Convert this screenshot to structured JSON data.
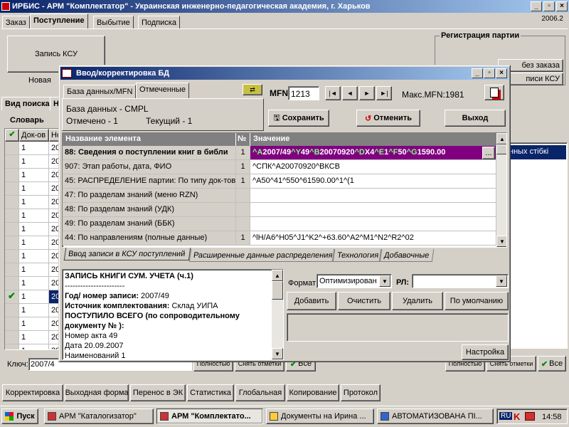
{
  "main_window": {
    "title": "ИРБИС - АРМ \"Комплектатор\" - Украинская инженерно-педагогическая академия, г. Харьков",
    "version": "2006.2",
    "tabs": [
      "Заказ",
      "Поступление",
      "Выбытие",
      "Подписка"
    ],
    "record_ksu": "Запись КСУ",
    "new_label": "Новая",
    "registration": "Регистрация партии",
    "btn_order": "без заказа",
    "btn_ksu": "писи КСУ",
    "search_tabs": [
      "Вид поиска",
      "Н"
    ],
    "dictionary": "Словарь",
    "grid_cols": [
      "Док-ов",
      "Но"
    ],
    "rows": [
      "1",
      "1",
      "1",
      "1",
      "1",
      "1",
      "1",
      "1",
      "1",
      "1",
      "1",
      "1",
      "1",
      "1",
      "1",
      "1"
    ],
    "right_cell": "нных стібкі",
    "key_label": "Ключ:",
    "key_value": "2007/4",
    "btn_full": "Полностью",
    "btn_clear": "Снять отметки",
    "btn_all": "Все"
  },
  "bottom_tabs": [
    "Корректировка",
    "Выходная форма",
    "Перенос в ЭК",
    "Статистика",
    "Глобальная",
    "Копирование",
    "Протокол"
  ],
  "taskbar": {
    "start": "Пуск",
    "tasks": [
      "АРМ \"Каталогизатор\"",
      "АРМ \"Комплектато...",
      "Документы на Ирина ...",
      "АВТОМАТИЗОВАНА ПІ..."
    ],
    "lang": "RU",
    "time": "14:58"
  },
  "dialog": {
    "title": "Ввод/корректировка БД",
    "db_tabs": [
      "База данных/MFN",
      "Отмеченные"
    ],
    "db_label": "База данных -",
    "db_name": "CMPL",
    "marked": "Отмечено - 1",
    "current": "Текущий - 1",
    "mfn_label": "MFN",
    "mfn_value": "1213",
    "max_mfn": "Макс.MFN:1981",
    "nav": [
      "|◄",
      "◄",
      "►",
      "►|"
    ],
    "btn_save": "Сохранить",
    "btn_cancel": "Отменить",
    "btn_exit": "Выход",
    "cols": [
      "Название элемента",
      "№",
      "Значение"
    ],
    "rows": [
      {
        "name": "88: Сведения о поступлении книг в библи",
        "num": "1",
        "value": "^A2007/49^Y49^B20070920^DX4^E1^F50^G1590.00"
      },
      {
        "name": "907: Этап работы, дата, ФИО",
        "num": "1",
        "value": "^CПК^A20070920^BКСВ"
      },
      {
        "name": "45: РАСПРЕДЕЛЕНИЕ партии: По типу док-тов",
        "num": "1",
        "value": "^A50^41^550^61590.00^1^(1"
      },
      {
        "name": "47: По разделам знаний (меню RZN)",
        "num": "",
        "value": ""
      },
      {
        "name": "48: По разделам знаний (УДК)",
        "num": "",
        "value": ""
      },
      {
        "name": "49: По разделам знаний (ББК)",
        "num": "",
        "value": ""
      },
      {
        "name": "44: По направлениям (полные данные)",
        "num": "1",
        "value": "^lH/A6^H05^J1^K2^+63.60^A2^M1^N2^R2^02"
      }
    ],
    "value_colored": [
      [
        "^A",
        "#7fff7f"
      ],
      [
        "2007/49",
        "#fff"
      ],
      [
        "^Y",
        "#7fff7f"
      ],
      [
        "49",
        "#fff"
      ],
      [
        "^B",
        "#7fff7f"
      ],
      [
        "20070920",
        "#fff"
      ],
      [
        "^D",
        "#7fff7f"
      ],
      [
        "X4",
        "#fff"
      ],
      [
        "^E",
        "#7fff7f"
      ],
      [
        "1",
        "#fff"
      ],
      [
        "^F",
        "#7fff7f"
      ],
      [
        "50",
        "#fff"
      ],
      [
        "^G",
        "#7fff7f"
      ],
      [
        "1590.00",
        "#fff"
      ]
    ],
    "ellipsis": "...",
    "sub_tabs": [
      "Ввод записи в КСУ поступлений",
      "Расширенные данные распределения",
      "Технология",
      "Добавочные"
    ],
    "preview": [
      "ЗАПИСЬ КНИГИ СУМ. УЧЕТА (ч.1)",
      "-----------------------",
      "Год/ номер записи: 2007/49",
      "Источник комплектования: Склад УИПА",
      "ПОСТУПИЛО ВСЕГО (по сопроводительному",
      "документу № ):",
      "Номер акта 49",
      "Дата 20.09.2007",
      "Наименований 1"
    ],
    "format_label": "Формат",
    "format_value": "Оптимизирован",
    "rl_label": "РЛ:",
    "rl_value": "",
    "btn_add": "Добавить",
    "btn_clear": "Очистить",
    "btn_delete": "Удалить",
    "btn_default": "По умолчанию",
    "btn_settings": "Настройка"
  },
  "colors": {
    "selected": "#800080",
    "navy": "#0a246a",
    "face": "#d4d0c8"
  }
}
